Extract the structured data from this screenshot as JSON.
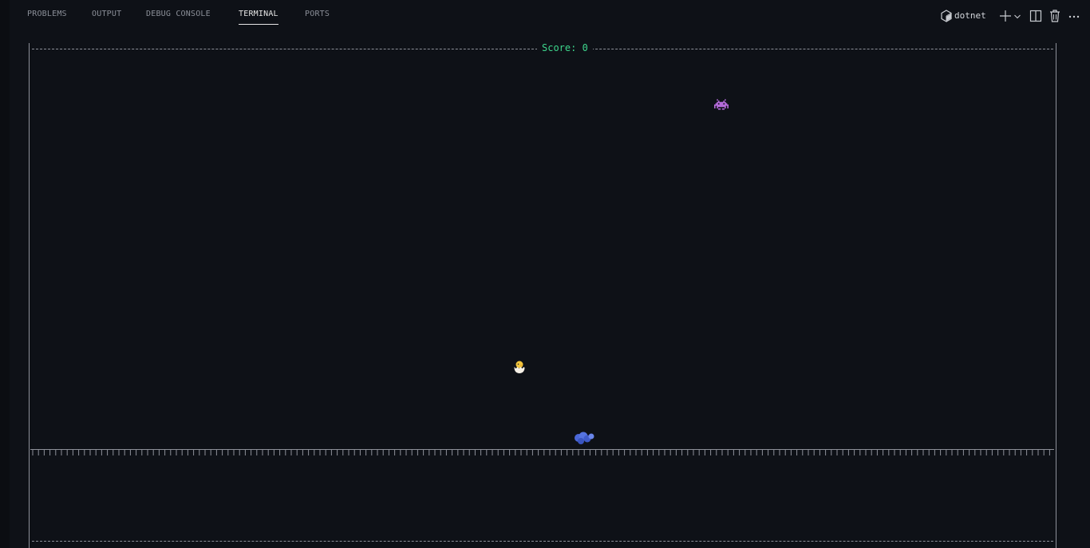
{
  "panel": {
    "tabs": [
      {
        "label": "PROBLEMS",
        "active": false
      },
      {
        "label": "OUTPUT",
        "active": false
      },
      {
        "label": "DEBUG CONSOLE",
        "active": false
      },
      {
        "label": "TERMINAL",
        "active": true
      },
      {
        "label": "PORTS",
        "active": false
      }
    ],
    "toolbar": {
      "terminal_profile": "dotnet",
      "icons": [
        "terminal-shell-icon",
        "add-terminal-icon",
        "chevron-down-icon",
        "split-terminal-icon",
        "trash-icon",
        "more-actions-icon"
      ]
    }
  },
  "game": {
    "score_label": "Score: 0",
    "score": 0,
    "sprites": [
      "space-invader-alien",
      "hatching-chick-player",
      "blue-blob-enemy"
    ],
    "colors": {
      "border": "#8d9099",
      "score": "#3dd68c",
      "alien": "#b46ad9",
      "chick": "#f2c53d",
      "blob": "#4a67d8",
      "background": "#0e1117"
    }
  }
}
